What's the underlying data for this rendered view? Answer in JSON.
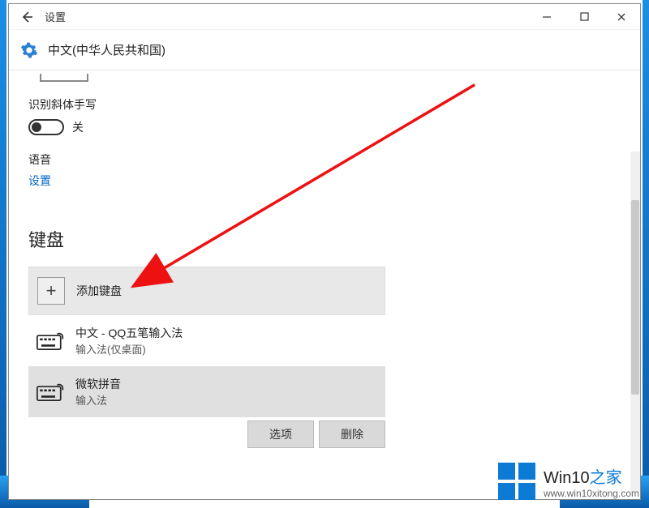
{
  "window": {
    "title": "设置",
    "language": "中文(中华人民共和国)"
  },
  "handwriting": {
    "label": "识别斜体手写",
    "state_label": "关"
  },
  "voice": {
    "label": "语音",
    "link": "设置"
  },
  "keyboard": {
    "heading": "键盘",
    "add_label": "添加键盘",
    "items": [
      {
        "title": "中文 - QQ五笔输入法",
        "sub": "输入法(仅桌面)"
      },
      {
        "title": "微软拼音",
        "sub": "输入法"
      }
    ],
    "actions": {
      "options": "选项",
      "remove": "删除"
    }
  },
  "watermark": {
    "brand_a": "Win10",
    "brand_b": "之家",
    "url": "www.win10xitong.com"
  }
}
